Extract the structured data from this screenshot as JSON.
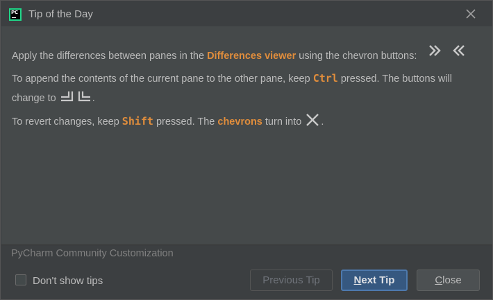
{
  "window": {
    "title": "Tip of the Day"
  },
  "tip": {
    "line1": {
      "before": "Apply the differences between panes in the ",
      "highlight": "Differences viewer",
      "after": " using the chevron buttons:"
    },
    "line2": {
      "before": "To append the contents of the current pane to the other pane, keep ",
      "key": "Ctrl",
      "after": " pressed. The buttons will"
    },
    "line3": {
      "before": "change to ",
      "after": "."
    },
    "line4": {
      "before": "To revert changes, keep ",
      "key": "Shift",
      "middle": " pressed. The ",
      "highlight": "chevrons",
      "after": " turn into ",
      "end": "."
    }
  },
  "footer": {
    "customization": "PyCharm Community Customization",
    "dont_show": "Don't show tips",
    "dont_show_checked": false
  },
  "buttons": {
    "previous": "Previous Tip",
    "next_first": "N",
    "next_rest": "ext Tip",
    "close_first": "C",
    "close_rest": "lose"
  },
  "colors": {
    "accent": "#e08d3c",
    "primary_button": "#365880",
    "background": "#3c3f41",
    "content_bg": "#45494a"
  },
  "icons": {
    "app": "pycharm-icon",
    "close": "close-icon",
    "chevrons": "apply-chevrons-icon",
    "append": "append-arrows-icon",
    "revert": "revert-cross-icon"
  }
}
